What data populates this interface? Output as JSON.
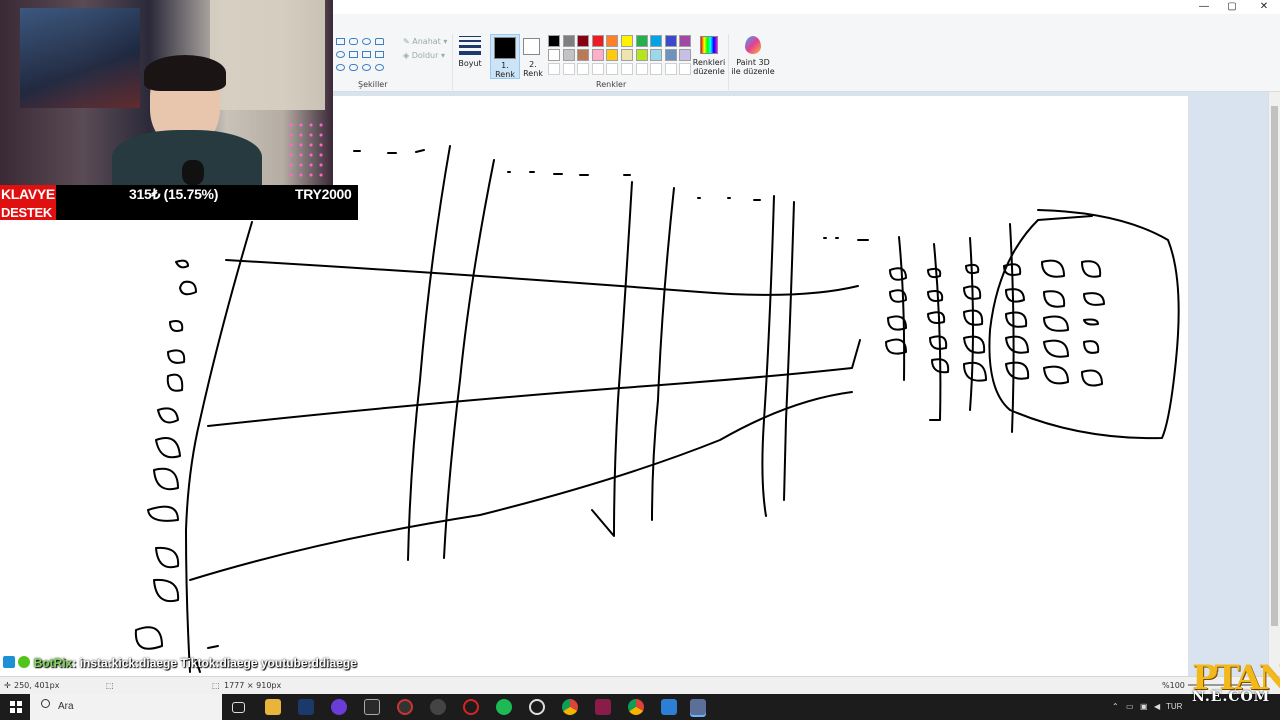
{
  "window": {
    "minimize": "—",
    "maximize": "▢",
    "close": "✕"
  },
  "ribbon": {
    "shapes_label": "Şekiller",
    "outline_label": "Anahat",
    "fill_label": "Doldur",
    "size_label": "Boyut",
    "color1_label": "1. Renk",
    "color2_label": "2. Renk",
    "colors_label": "Renkler",
    "edit_colors_label": "Renkleri düzenle",
    "paint3d_label": "Paint 3D ile düzenle",
    "palette_row1": [
      "#000000",
      "#7f7f7f",
      "#880015",
      "#ed1c24",
      "#ff7f27",
      "#fff200",
      "#22b14c",
      "#00a2e8",
      "#3f48cc",
      "#a349a4"
    ],
    "palette_row2": [
      "#ffffff",
      "#c3c3c3",
      "#b97a57",
      "#ffaec9",
      "#ffc90e",
      "#efe4b0",
      "#b5e61d",
      "#99d9ea",
      "#7092be",
      "#c8bfe7"
    ]
  },
  "overlay": {
    "klavye": "KLAVYE",
    "destek": "DESTEK",
    "progress": "315₺ (15.75%)",
    "goal": "TRY2000"
  },
  "chat": {
    "user": "BotRix",
    "message": ": insta:kick:diaege Tiktok:diaege youtube:ddiaege"
  },
  "status": {
    "cursor": "250, 401px",
    "canvas_size": "1777 × 910px",
    "zoom": "%100"
  },
  "taskbar": {
    "search_placeholder": "Ara",
    "lang": "TUR"
  },
  "watermark": "PTAN",
  "watermark_sub": "N.E.COM"
}
